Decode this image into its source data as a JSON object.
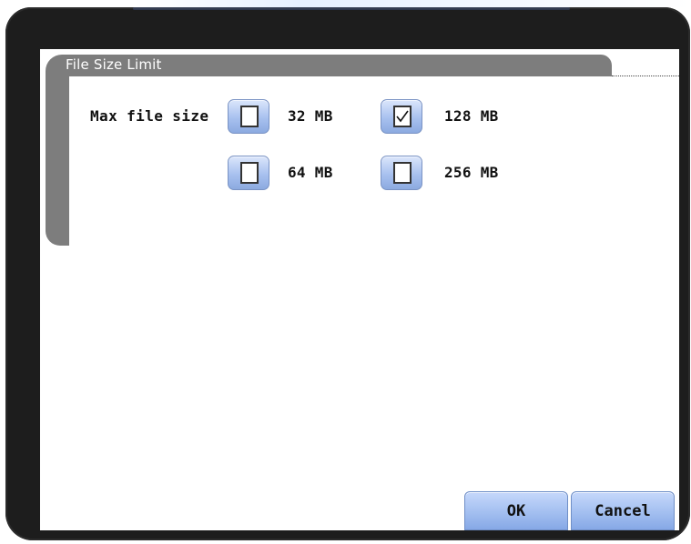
{
  "dialog": {
    "group_title": "File Size Limit",
    "field_label": "Max file size"
  },
  "options": [
    {
      "label": "32 MB",
      "checked": false
    },
    {
      "label": "128 MB",
      "checked": true
    },
    {
      "label": "64 MB",
      "checked": false
    },
    {
      "label": "256 MB",
      "checked": false
    }
  ],
  "buttons": {
    "ok_label": "OK",
    "cancel_label": "Cancel"
  },
  "colors": {
    "group_frame": "#7d7d7d",
    "button_blue": "#a3bff0",
    "bezel": "#1d1d1d"
  }
}
